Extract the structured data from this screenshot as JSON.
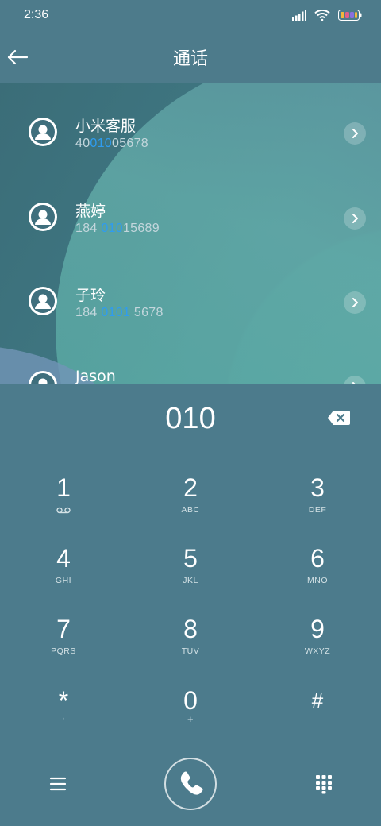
{
  "status": {
    "time": "2:36"
  },
  "header": {
    "title": "通话"
  },
  "contacts": [
    {
      "name": "小米客服",
      "num_pre": "40",
      "num_hl": "010",
      "num_post": "05678"
    },
    {
      "name": "燕婷",
      "num_pre": "184 ",
      "num_hl": "010",
      "num_post": "15689"
    },
    {
      "name": "子玲",
      "num_pre": "184 ",
      "num_hl": "0101",
      "num_post": " 5678"
    },
    {
      "name": "Jason",
      "num_pre": "",
      "num_hl": "",
      "num_post": ""
    }
  ],
  "dialpad": {
    "input": "010",
    "keys": [
      {
        "num": "1",
        "sub": "voicemail-icon"
      },
      {
        "num": "2",
        "sub": "ABC"
      },
      {
        "num": "3",
        "sub": "DEF"
      },
      {
        "num": "4",
        "sub": "GHI"
      },
      {
        "num": "5",
        "sub": "JKL"
      },
      {
        "num": "6",
        "sub": "MNO"
      },
      {
        "num": "7",
        "sub": "PQRS"
      },
      {
        "num": "8",
        "sub": "TUV"
      },
      {
        "num": "9",
        "sub": "WXYZ"
      },
      {
        "num": "*",
        "sub": ","
      },
      {
        "num": "0",
        "sub": "+"
      },
      {
        "num": "#",
        "sub": ""
      }
    ]
  },
  "colors": {
    "highlight": "#2f9cf0",
    "background": "#4c7b8c"
  }
}
